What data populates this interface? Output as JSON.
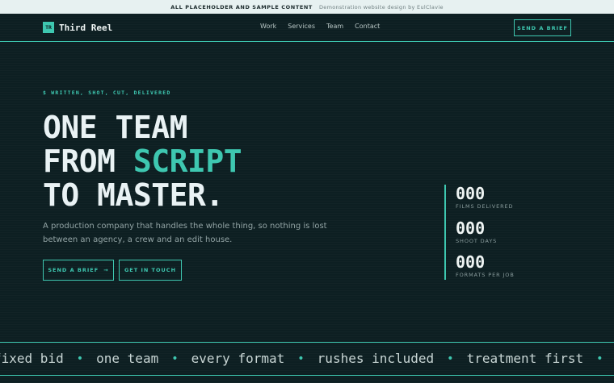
{
  "banner": {
    "label": "ALL PLACEHOLDER AND SAMPLE CONTENT",
    "credit": "Demonstration website design by EulClavie"
  },
  "header": {
    "logo_mark": "TR",
    "logo_text": "Third Reel",
    "nav": [
      "Work",
      "Services",
      "Team",
      "Contact"
    ],
    "cta": "SEND A BRIEF"
  },
  "hero": {
    "eyebrow": "$ WRITTEN, SHOT, CUT, DELIVERED",
    "line1": "ONE TEAM",
    "line2_a": "FROM ",
    "line2_b": "SCRIPT",
    "line3": "TO MASTER.",
    "subtitle": "A production company that handles the whole thing, so nothing is lost between an agency, a crew and an edit house.",
    "primary_button": "SEND A BRIEF",
    "primary_arrow": "→",
    "secondary_button": "GET IN TOUCH"
  },
  "stats": [
    {
      "value": "000",
      "label": "FILMS DELIVERED"
    },
    {
      "value": "000",
      "label": "SHOOT DAYS"
    },
    {
      "value": "000",
      "label": "FORMATS PER JOB"
    }
  ],
  "marquee": {
    "items": [
      "fixed bid",
      "one team",
      "every format",
      "rushes included",
      "treatment first"
    ],
    "separator": "•"
  },
  "colors": {
    "background": "#0d1f22",
    "accent": "#3ec7b0",
    "banner_bg": "#e7f1f1"
  }
}
